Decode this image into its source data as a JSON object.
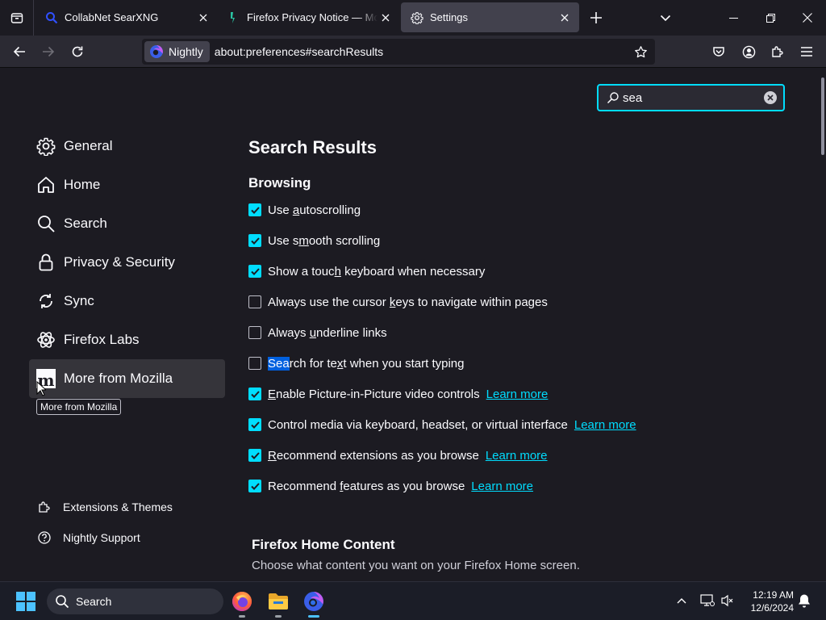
{
  "tabs": [
    {
      "title": "CollabNet SearXNG",
      "favicon": "search-favicon"
    },
    {
      "title": "Firefox Privacy Notice — Mozilla",
      "favicon": "mozilla-favicon"
    },
    {
      "title": "Settings",
      "favicon": "gear-favicon",
      "selected": true
    }
  ],
  "navbar": {
    "identity_label": "Nightly",
    "url": "about:preferences#searchResults"
  },
  "settings_search": {
    "value": "sea"
  },
  "categories": [
    {
      "label": "General",
      "icon": "gear-icon"
    },
    {
      "label": "Home",
      "icon": "home-icon"
    },
    {
      "label": "Search",
      "icon": "search-icon"
    },
    {
      "label": "Privacy & Security",
      "icon": "lock-icon"
    },
    {
      "label": "Sync",
      "icon": "sync-icon"
    },
    {
      "label": "Firefox Labs",
      "icon": "labs-icon"
    },
    {
      "label": "More from Mozilla",
      "icon": "mozilla-m-icon",
      "hovered": true
    }
  ],
  "tooltip": "More from Mozilla",
  "footer_links": [
    {
      "label": "Extensions & Themes",
      "icon": "puzzle-icon"
    },
    {
      "label": "Nightly Support",
      "icon": "help-icon"
    }
  ],
  "main": {
    "title": "Search Results",
    "section": "Browsing",
    "options": {
      "autoscroll": {
        "pre": "Use ",
        "key": "a",
        "post": "utoscrolling",
        "checked": true
      },
      "smooth": {
        "pre": "Use s",
        "key": "m",
        "post": "ooth scrolling",
        "checked": true
      },
      "touch_keyboard": {
        "pre": "Show a touc",
        "key": "h",
        "post": " keyboard when necessary",
        "checked": true
      },
      "cursor_keys": {
        "pre": "Always use the cursor ",
        "key": "k",
        "post": "eys to navigate within pages",
        "checked": false
      },
      "underline": {
        "pre": "Always ",
        "key": "u",
        "post": "nderline links",
        "checked": false
      },
      "find_typing": {
        "highlight": "Sea",
        "mid": "rch for te",
        "key": "x",
        "post": "t when you start typing",
        "checked": false
      },
      "pip": {
        "pre": "",
        "key": "E",
        "post": "nable Picture-in-Picture video controls",
        "checked": true,
        "link": "Learn more"
      },
      "media": {
        "label": "Control media via keyboard, headset, or virtual interface",
        "checked": true,
        "link": "Learn more"
      },
      "rec_ext": {
        "pre": "",
        "key": "R",
        "post": "ecommend extensions as you browse",
        "checked": true,
        "link": "Learn more"
      },
      "rec_feat": {
        "pre": "Recommend ",
        "key": "f",
        "post": "eatures as you browse",
        "checked": true,
        "link": "Learn more"
      }
    },
    "home_title": "Firefox Home Content",
    "home_desc": "Choose what content you want on your Firefox Home screen."
  },
  "taskbar": {
    "search_label": "Search",
    "time": "12:19 AM",
    "date": "12/6/2024"
  },
  "colors": {
    "accent": "#00ddff",
    "selection": "#0060df"
  }
}
